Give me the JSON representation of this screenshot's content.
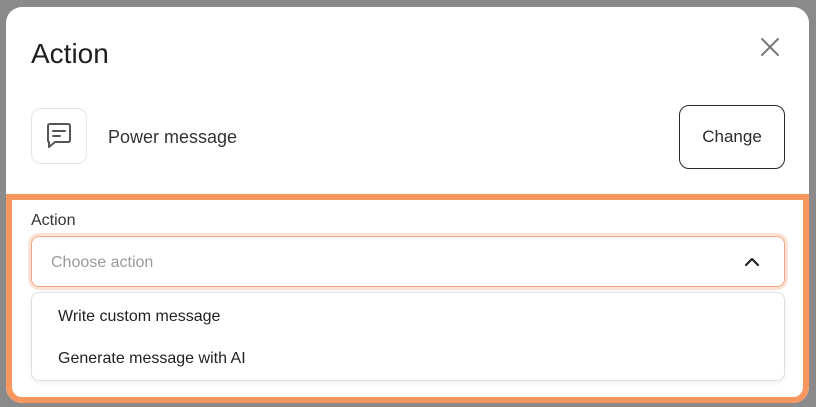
{
  "modal": {
    "title": "Action",
    "close_icon": "close-icon"
  },
  "node": {
    "icon": "message-icon",
    "label": "Power message",
    "change_label": "Change"
  },
  "action_field": {
    "label": "Action",
    "placeholder": "Choose action",
    "chevron_icon": "chevron-up-icon",
    "options": [
      "Write custom message",
      "Generate message with AI"
    ]
  },
  "colors": {
    "highlight": "#f7965e",
    "focus_ring": "#fde3d6"
  }
}
